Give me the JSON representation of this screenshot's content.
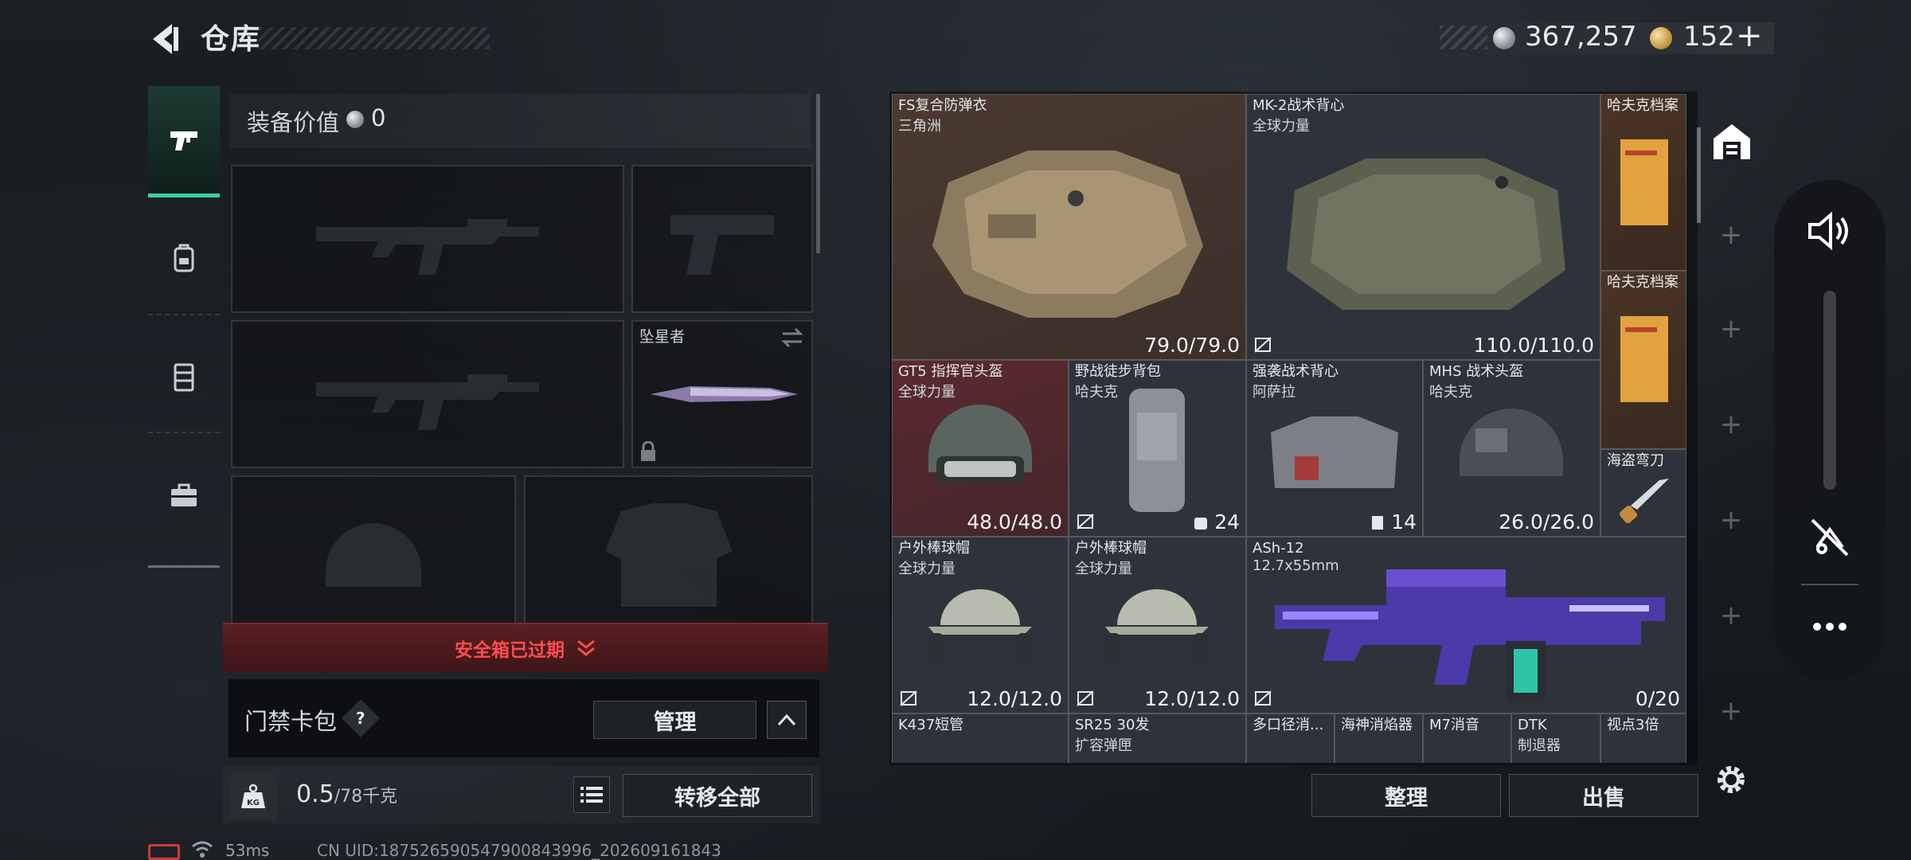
{
  "header": {
    "title": "仓库",
    "currency_silver": "367,257",
    "currency_gold": "152",
    "currency_add": "+"
  },
  "tabs": [
    {
      "icon": "pistol-icon",
      "active": true
    },
    {
      "icon": "backpack-icon",
      "active": false
    },
    {
      "icon": "vest-icon",
      "active": false
    },
    {
      "icon": "briefcase-icon",
      "active": false
    }
  ],
  "loadout": {
    "equip_value_label": "装备价值",
    "equip_value": "0",
    "melee_label": "坠星者",
    "safebox_text": "安全箱已过期",
    "keycard_label": "门禁卡包",
    "help": "?",
    "manage_label": "管理",
    "weight_value": "0.5",
    "weight_max": "/78千克",
    "weight_icon_text": "KG",
    "transfer_label": "转移全部"
  },
  "stash": {
    "items": [
      {
        "name": "FS复合防弹衣",
        "sub": "三角洲",
        "value": "79.0/79.0"
      },
      {
        "name": "MK-2战术背心",
        "sub": "全球力量",
        "value": "110.0/110.0"
      },
      {
        "name": "哈夫克档案",
        "sub": ""
      },
      {
        "name": "哈夫克档案",
        "sub": ""
      },
      {
        "name": "GT5 指挥官头盔",
        "sub": "全球力量",
        "value": "48.0/48.0"
      },
      {
        "name": "野战徒步背包",
        "sub": "哈夫克",
        "value": "24"
      },
      {
        "name": "强袭战术背心",
        "sub": "阿萨拉",
        "value": "14"
      },
      {
        "name": "MHS 战术头盔",
        "sub": "哈夫克",
        "value": "26.0/26.0"
      },
      {
        "name": "海盗弯刀",
        "sub": ""
      },
      {
        "name": "户外棒球帽",
        "sub": "全球力量",
        "value": "12.0/12.0"
      },
      {
        "name": "户外棒球帽",
        "sub": "全球力量",
        "value": "12.0/12.0"
      },
      {
        "name": "ASh-12",
        "sub": "12.7x55mm",
        "value": "0/20"
      },
      {
        "name": "K437短管",
        "sub": ""
      },
      {
        "name": "SR25 30发",
        "sub": "扩容弹匣"
      },
      {
        "name": "多口径消...",
        "sub": ""
      },
      {
        "name": "海神消焰器",
        "sub": ""
      },
      {
        "name": "M7消音",
        "sub": ""
      },
      {
        "name": "DTK",
        "sub": "制退器"
      },
      {
        "name": "视点3倍",
        "sub": ""
      }
    ],
    "sort_label": "整理",
    "sell_label": "出售",
    "side_plus": "+"
  },
  "status": {
    "ping": "53ms",
    "uid": "CN UID:18752659054790084399​6_202609161843"
  },
  "colors": {
    "accent": "#3fd0a0",
    "alert": "#ff4d4d",
    "safebox_bg": "#5a2024"
  }
}
